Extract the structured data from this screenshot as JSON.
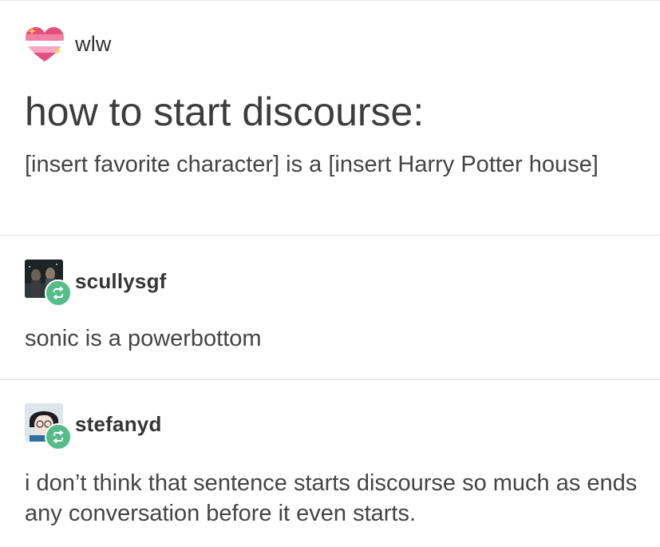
{
  "post": {
    "op_username": "wlw",
    "title": "how to start discourse:",
    "body": "[insert favorite character] is a [insert Harry Potter house]"
  },
  "reblogs": [
    {
      "username": "scullysgf",
      "text": "sonic is a powerbottom"
    },
    {
      "username": "stefanyd",
      "text": "i don’t think that sentence starts discourse so much as ends any conversation before it even starts."
    }
  ],
  "colors": {
    "reblog_badge": "#56bc8a",
    "heart_pink": "#f06c9b",
    "heart_white": "#ffffff",
    "heart_peach": "#f4a07a",
    "sparkle": "#ffcc4d"
  },
  "icons": {
    "op_avatar": "heart-stripes-icon",
    "reblog": "reblog-icon"
  }
}
